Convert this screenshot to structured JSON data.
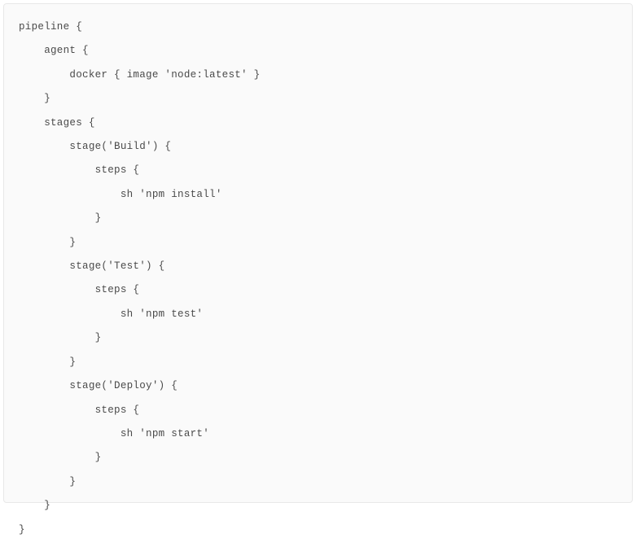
{
  "code": {
    "lines": [
      "pipeline {",
      "    agent {",
      "        docker { image 'node:latest' }",
      "    }",
      "    stages {",
      "        stage('Build') {",
      "            steps {",
      "                sh 'npm install'",
      "            }",
      "        }",
      "        stage('Test') {",
      "            steps {",
      "                sh 'npm test'",
      "            }",
      "        }",
      "        stage('Deploy') {",
      "            steps {",
      "                sh 'npm start'",
      "            }",
      "        }",
      "    }",
      "}"
    ]
  }
}
